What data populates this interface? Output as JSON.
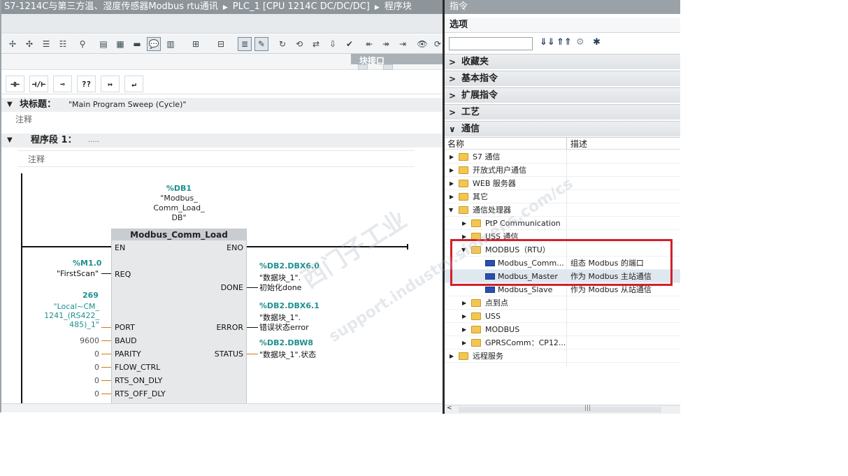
{
  "editor": {
    "breadcrumb": [
      "S7-1214C与第三方温、湿度传感器Modbus rtu通讯",
      "PLC_1 [CPU 1214C DC/DC/DC]",
      "程序块"
    ],
    "interface_label": "块接口",
    "block_title_label": "块标题：",
    "block_title_value": "\"Main Program Sweep (Cycle)\"",
    "block_comment": "注释",
    "network_label": "程序段 1：",
    "network_dots": ".....",
    "network_comment": "注释",
    "ladder_buttons": [
      "⊣⊢",
      "⊣/⊢",
      "⊸",
      "??",
      "↦",
      "↵"
    ]
  },
  "ladder": {
    "db_instance": {
      "address": "%DB1",
      "name_lines": [
        "\"Modbus_",
        "Comm_Load_",
        "DB\""
      ]
    },
    "block_name": "Modbus_Comm_Load",
    "inputs": [
      "EN",
      "REQ",
      "PORT",
      "BAUD",
      "PARITY",
      "FLOW_CTRL",
      "RTS_ON_DLY",
      "RTS_OFF_DLY"
    ],
    "outputs": [
      "ENO",
      "DONE",
      "ERROR",
      "STATUS"
    ],
    "req": {
      "address": "%M1.0",
      "name": "\"FirstScan\""
    },
    "port": {
      "value": "269",
      "name_lines": [
        "\"Local~CM_",
        "1241_(RS422_",
        "485)_1\""
      ]
    },
    "baud": "9600",
    "parity": "0",
    "flow_ctrl": "0",
    "rts_on": "0",
    "rts_off": "0",
    "done": {
      "address": "%DB2.DBX6.0",
      "line1": "\"数据块_1\".",
      "line2": "初始化done"
    },
    "error": {
      "address": "%DB2.DBX6.1",
      "line1": "\"数据块_1\".",
      "line2": "错误状态error"
    },
    "status": {
      "address": "%DB2.DBW8",
      "line1": "\"数据块_1\".状态"
    }
  },
  "panel": {
    "title": "指令",
    "options": "选项",
    "search_value": "",
    "categories": [
      "收藏夹",
      "基本指令",
      "扩展指令",
      "工艺",
      "通信"
    ],
    "col_name": "名称",
    "col_desc": "描述",
    "tree": [
      {
        "name": "S7 通信",
        "desc": ""
      },
      {
        "name": "开放式用户通信",
        "desc": ""
      },
      {
        "name": "WEB 服务器",
        "desc": ""
      },
      {
        "name": "其它",
        "desc": ""
      },
      {
        "name": "通信处理器",
        "desc": ""
      },
      {
        "name": "PtP Communication",
        "desc": ""
      },
      {
        "name": "USS 通信",
        "desc": ""
      },
      {
        "name": "MODBUS（RTU）",
        "desc": ""
      },
      {
        "name": "Modbus_Comm...",
        "desc": "组态 Modbus 的端口"
      },
      {
        "name": "Modbus_Master",
        "desc": "作为 Modbus 主站通信"
      },
      {
        "name": "Modbus_Slave",
        "desc": "作为 Modbus 从站通信"
      },
      {
        "name": "点到点",
        "desc": ""
      },
      {
        "name": "USS",
        "desc": ""
      },
      {
        "name": "MODBUS",
        "desc": ""
      },
      {
        "name": "GPRSComm：CP12...",
        "desc": ""
      },
      {
        "name": "远程服务",
        "desc": ""
      }
    ],
    "scroll_label": "|||"
  },
  "watermark": [
    "西门子工业",
    "support.industry.siemens.com/cs"
  ]
}
